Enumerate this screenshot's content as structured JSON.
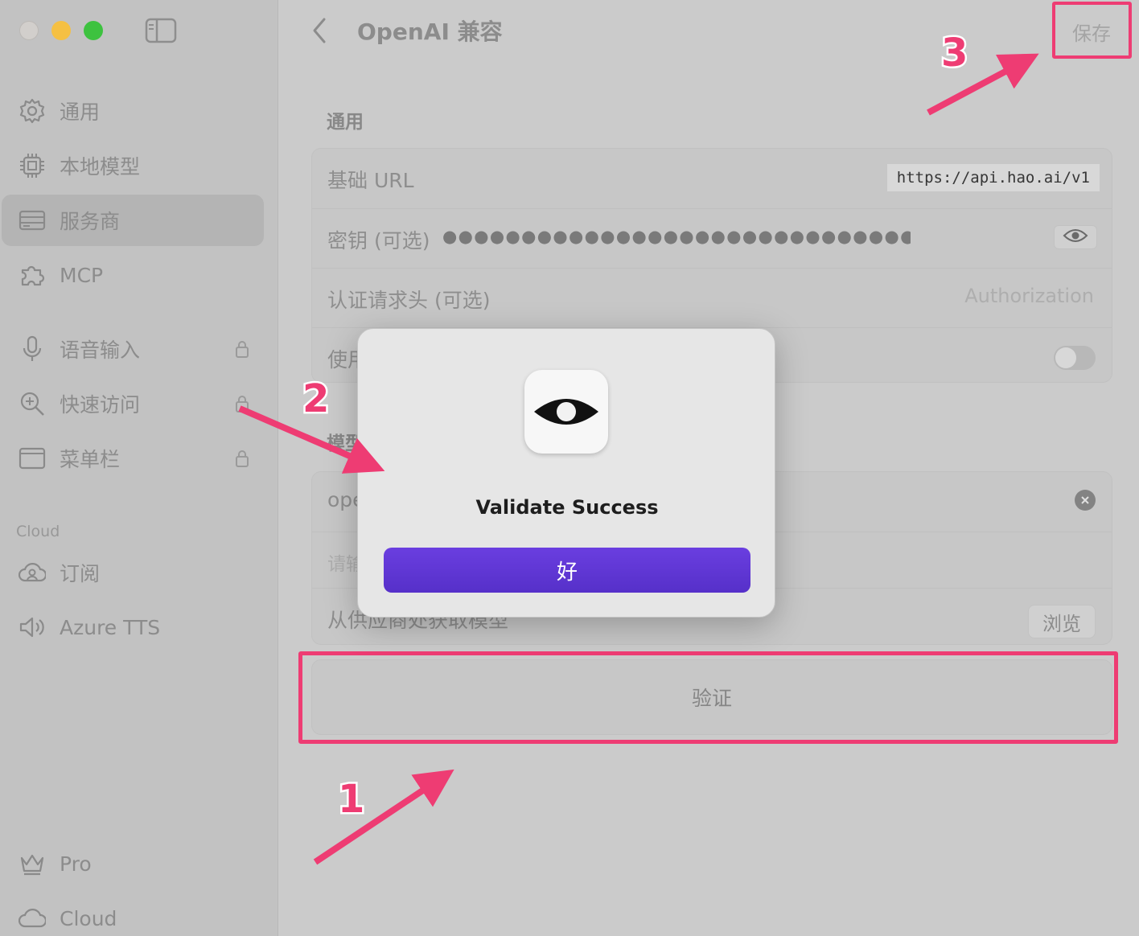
{
  "sidebar": {
    "items": [
      {
        "label": "通用",
        "icon": "gear-icon"
      },
      {
        "label": "本地模型",
        "icon": "chip-icon"
      },
      {
        "label": "服务商",
        "icon": "server-icon",
        "selected": true
      },
      {
        "label": "MCP",
        "icon": "puzzle-icon"
      },
      {
        "label": "语音输入",
        "icon": "microphone-icon",
        "locked": true
      },
      {
        "label": "快速访问",
        "icon": "zoom-search-icon",
        "locked": true
      },
      {
        "label": "菜单栏",
        "icon": "window-icon",
        "locked": true
      }
    ],
    "cloud_section": {
      "label": "Cloud",
      "items": [
        {
          "label": "订阅",
          "icon": "cloud-person-icon"
        },
        {
          "label": "Azure TTS",
          "icon": "speaker-icon"
        }
      ]
    },
    "footer_items": [
      {
        "label": "Pro",
        "icon": "crown-icon"
      },
      {
        "label": "Cloud",
        "icon": "cloud-icon"
      }
    ]
  },
  "header": {
    "title": "OpenAI 兼容",
    "save_label": "保存"
  },
  "general": {
    "section_title": "通用",
    "base_url_label": "基础 URL",
    "base_url_value": "https://api.hao.ai/v1",
    "api_key_label": "密钥 (可选)",
    "api_key_masked": "●●●●●●●●●●●●●●●●●●●●●●●●●●●●●●●●●●●●●●●●●●●●●●●",
    "auth_header_label": "认证请求头 (可选)",
    "auth_header_placeholder": "Authorization",
    "toggle_label_partial": "使用",
    "toggle_on": false
  },
  "models": {
    "section_title_partial": "模型",
    "model_value_partial": "ope",
    "model_placeholder_partial": "请输",
    "fetch_label": "从供应商处获取模型",
    "browse_label": "浏览"
  },
  "validate_label": "验证",
  "dialog": {
    "message": "Validate Success",
    "ok_label": "好",
    "icon": "eye-logo-icon"
  },
  "annotations": {
    "steps": [
      "1",
      "2",
      "3"
    ],
    "color": "#ee3c73"
  }
}
